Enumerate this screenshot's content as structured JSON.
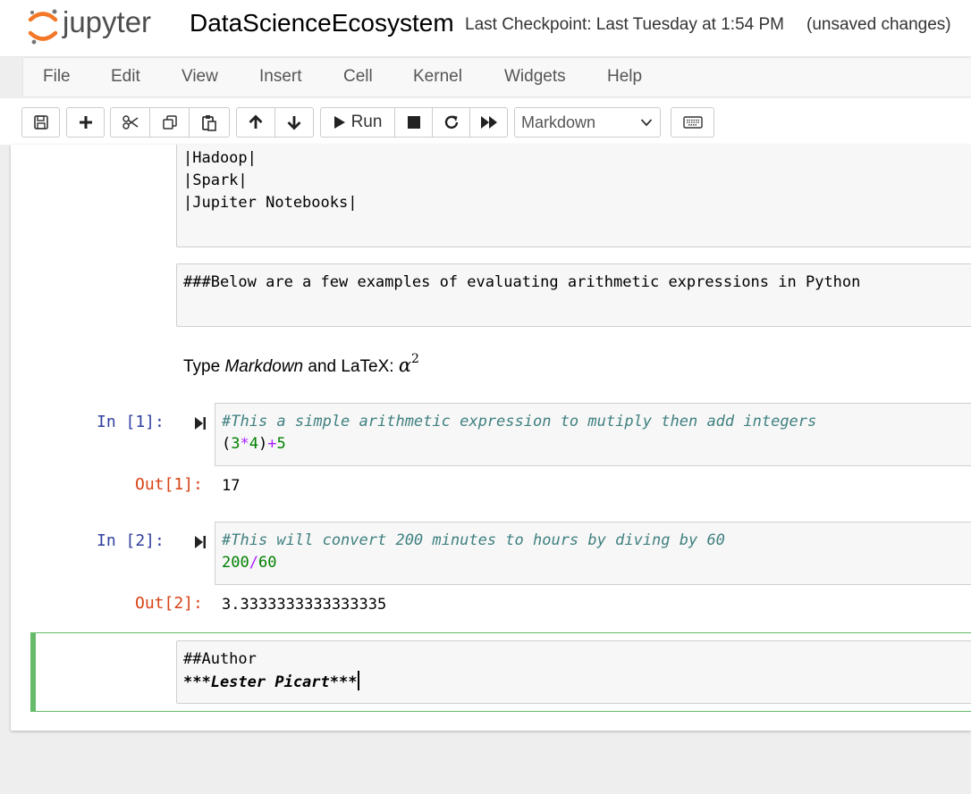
{
  "header": {
    "logo_text": "jupyter",
    "notebook_name": "DataScienceEcosystem",
    "checkpoint": "Last Checkpoint: Last Tuesday at 1:54 PM",
    "autosave_status": "(unsaved changes)"
  },
  "menubar": {
    "items": [
      {
        "label": "File"
      },
      {
        "label": "Edit"
      },
      {
        "label": "View"
      },
      {
        "label": "Insert"
      },
      {
        "label": "Cell"
      },
      {
        "label": "Kernel"
      },
      {
        "label": "Widgets"
      },
      {
        "label": "Help"
      }
    ]
  },
  "toolbar": {
    "icons": [
      "save-icon",
      "plus-icon",
      "scissors-icon",
      "copy-icon",
      "paste-icon",
      "arrow-up-icon",
      "arrow-down-icon",
      "play-icon",
      "stop-icon",
      "restart-icon",
      "fast-forward-icon",
      "keyboard-icon"
    ],
    "run_label": "Run",
    "cell_type_selected": "Markdown"
  },
  "cells": {
    "md_list": {
      "lines": [
        "|Hadoop|",
        "|Spark|",
        "|Jupiter Notebooks|"
      ]
    },
    "md_heading": {
      "text": "###Below are a few examples of evaluating arithmetic expressions in Python"
    },
    "rendered_md": {
      "prefix": "Type ",
      "italic": "Markdown",
      "middle": " and LaTeX: ",
      "math_symbol": "α",
      "math_exponent": "2"
    },
    "code1": {
      "prompt_in": "In [1]:",
      "comment": "#This a simple arithmetic expression to mutiply then add integers",
      "tok_paren_open": "(",
      "tok_3": "3",
      "tok_mul": "*",
      "tok_4": "4",
      "tok_paren_close": ")",
      "tok_plus": "+",
      "tok_5": "5",
      "prompt_out": "Out[1]:",
      "output": "17"
    },
    "code2": {
      "prompt_in": "In [2]:",
      "comment": "#This will convert 200 minutes to hours by diving by 60",
      "tok_200": "200",
      "tok_div": "/",
      "tok_60": "60",
      "prompt_out": "Out[2]:",
      "output": "3.3333333333333335"
    },
    "md_author": {
      "line1": "##Author",
      "line2": "***Lester Picart***"
    }
  },
  "colors": {
    "prompt_in": "#303f9f",
    "prompt_out": "#d84315",
    "comment": "#408080",
    "number": "#008000",
    "operator": "#aa22ff",
    "selected_border": "#66bb6a",
    "logo_orange": "#f37726"
  }
}
